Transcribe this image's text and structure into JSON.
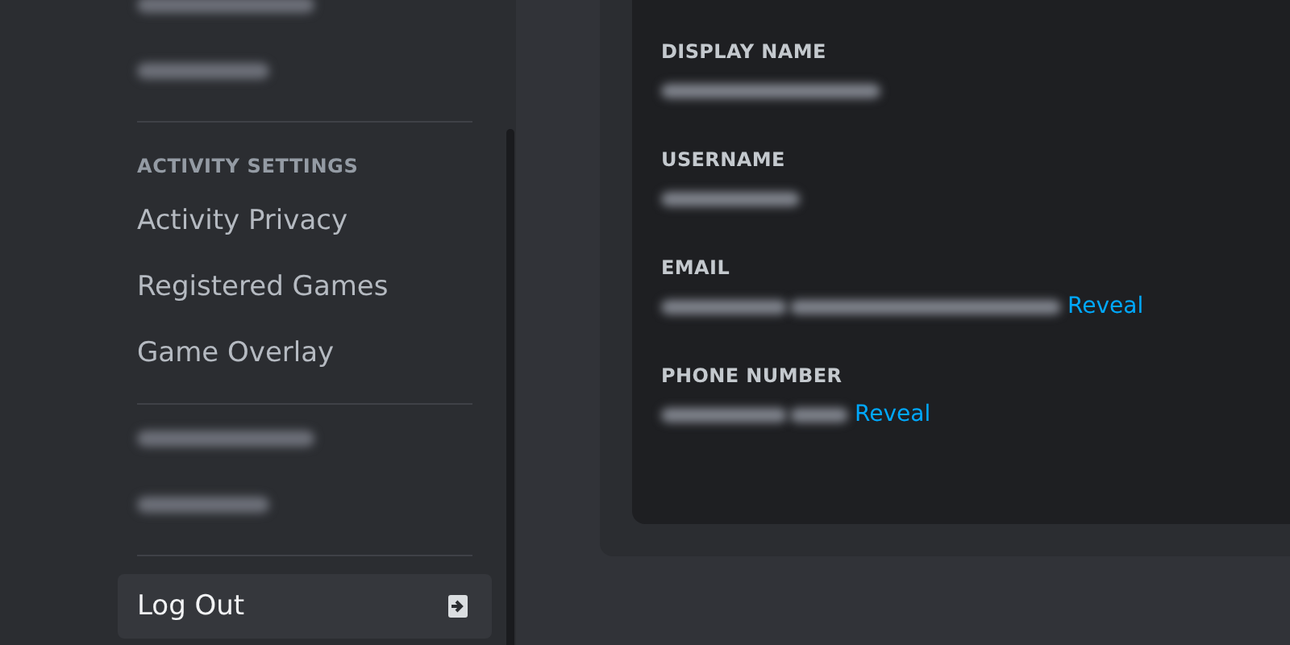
{
  "sidebar": {
    "groups": [
      {
        "items": [
          {
            "kind": "redacted"
          },
          {
            "kind": "redacted"
          }
        ]
      },
      {
        "header": "ACTIVITY SETTINGS",
        "items": [
          {
            "kind": "text",
            "label": "Activity Privacy",
            "selected": false
          },
          {
            "kind": "text",
            "label": "Registered Games",
            "selected": false
          },
          {
            "kind": "text",
            "label": "Game Overlay",
            "selected": false
          }
        ]
      },
      {
        "items": [
          {
            "kind": "redacted"
          },
          {
            "kind": "redacted"
          }
        ]
      },
      {
        "items": [
          {
            "kind": "logout",
            "label": "Log Out",
            "selected": true
          }
        ]
      }
    ]
  },
  "account": {
    "fields": [
      {
        "label": "DISPLAY NAME"
      },
      {
        "label": "USERNAME"
      },
      {
        "label": "EMAIL",
        "action": "Reveal"
      },
      {
        "label": "PHONE NUMBER",
        "action": "Reveal"
      }
    ]
  }
}
